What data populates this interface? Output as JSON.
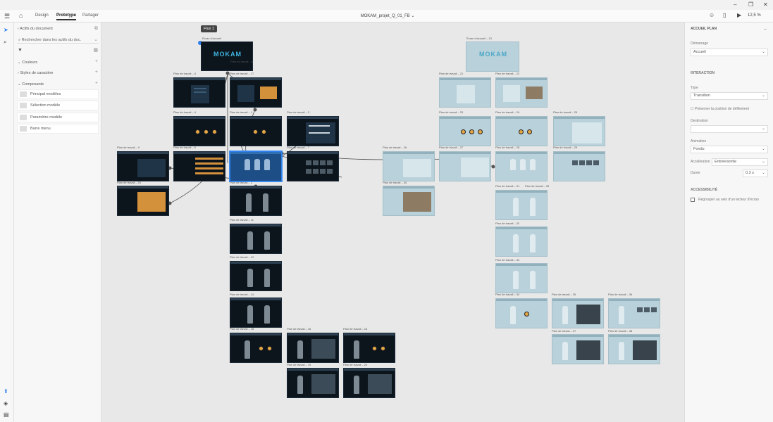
{
  "app": {
    "document_title": "MOKAM_projet_Q_01_FB",
    "zoom": "12,5 %"
  },
  "appbar": {
    "tabs": [
      {
        "label": "Design"
      },
      {
        "label": "Prototype"
      },
      {
        "label": "Partager"
      }
    ]
  },
  "left_panel": {
    "header": "Actifs du document",
    "search_placeholder": "Rechercher dans les actifs du doc.",
    "sections": [
      {
        "label": "Couleurs"
      },
      {
        "label": "Styles de caractère"
      },
      {
        "label": "Composants"
      }
    ],
    "components": [
      {
        "label": "Principal modèles"
      },
      {
        "label": "Sélection modèle"
      },
      {
        "label": "Paramètre modèle"
      },
      {
        "label": "Barre menu"
      }
    ]
  },
  "right_panel": {
    "header": "ACCUEIL PLAN",
    "launch_label": "Démarrage",
    "launch_value": "Accueil",
    "interaction_header": "INTERACTION",
    "type_label": "Type",
    "type_value": "Transition",
    "preserve_label": "Préserver la position de défilement",
    "destination_label": "Destination",
    "animation_label": "Animation",
    "animation_value": "Fondu",
    "easing_label": "Accélération",
    "easing_value": "Entrée/sortie",
    "duration_label": "Durée",
    "duration_value": "0,3 s",
    "accessibility_header": "ACCESSIBILITÉ",
    "accessibility_check": "Regrouper au sein d'un lecteur d'écran"
  },
  "canvas": {
    "flow_tag": "Flux 1",
    "flow_start_label": "Écran d'accueil",
    "ghost_home_label": "Écran d'accueil – 13",
    "labels": {
      "plan_1": "Plan de travail – 1",
      "plan_2": "Plan de travail – 2",
      "plan_3": "Plan de travail – 3",
      "plan_4": "Plan de travail – 4",
      "plan_5": "Plan de travail – 5",
      "plan_6": "Plan de travail – 6",
      "plan_7": "Plan de travail – 7",
      "plan_8": "Plan de travail – 8",
      "plan_9": "Plan de travail – 9",
      "plan_10": "Plan de travail – 10",
      "plan_11": "Plan de travail – 11",
      "plan_12": "Plan de travail – 12",
      "plan_14": "Plan de travail – 14",
      "plan_15": "Plan de travail – 15",
      "plan_16": "Plan de travail – 16",
      "plan_17": "Plan de travail – 17",
      "plan_18": "Plan de travail – 18",
      "plan_19": "Plan de travail – 19",
      "plan_20": "Plan de travail – 20",
      "plan_21": "Plan de travail – 21",
      "plan_22": "Plan de travail – 22",
      "plan_23": "Plan de travail – 23",
      "plan_24": "Plan de travail – 24",
      "plan_25": "Plan de travail – 25",
      "plan_26": "Plan de travail – 26",
      "plan_27": "Plan de travail – 27",
      "plan_28": "Plan de travail – 28",
      "plan_29": "Plan de travail – 29",
      "plan_30": "Plan de travail – 30",
      "plan_31": "Plan de travail – 31",
      "plan_32": "Plan de travail – 32",
      "plan_33": "Plan de travail – 33",
      "plan_34": "Plan de travail – 34",
      "plan_35": "Plan de travail – 35",
      "plan_36": "Plan de travail – 36",
      "plan_37": "Plan de travail – 37",
      "plan_38": "Plan de travail – 38",
      "plan_39": "Plan de travail – 39"
    },
    "logo_text": "MOKAM"
  }
}
